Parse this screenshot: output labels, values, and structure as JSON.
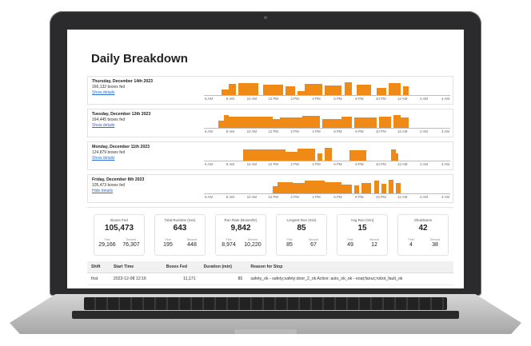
{
  "page": {
    "title": "Daily Breakdown"
  },
  "hours": [
    "6 AM",
    "8 AM",
    "10 AM",
    "12 PM",
    "2 PM",
    "4 PM",
    "6 PM",
    "8 PM",
    "10 PM",
    "12 AM",
    "2 AM",
    "4 AM"
  ],
  "days": [
    {
      "date": "Thursday, December 14th 2023",
      "boxes": "166,132 boxes fed",
      "link": "Show details",
      "runs": [
        [
          0.07,
          0.1,
          0.4
        ],
        [
          0.1,
          0.13,
          0.8
        ],
        [
          0.14,
          0.22,
          0.85
        ],
        [
          0.24,
          0.32,
          0.7
        ],
        [
          0.33,
          0.37,
          0.6
        ],
        [
          0.38,
          0.41,
          0.3
        ],
        [
          0.41,
          0.48,
          0.75
        ],
        [
          0.49,
          0.56,
          0.65
        ],
        [
          0.57,
          0.6,
          0.9
        ],
        [
          0.62,
          0.68,
          0.7
        ],
        [
          0.7,
          0.74,
          0.5
        ],
        [
          0.75,
          0.8,
          0.85
        ],
        [
          0.81,
          0.83,
          0.6
        ]
      ]
    },
    {
      "date": "Tuesday, December 12th 2023",
      "boxes": "164,445 boxes fed",
      "link": "Show details",
      "runs": [
        [
          0.06,
          0.08,
          0.5
        ],
        [
          0.08,
          0.1,
          0.9
        ],
        [
          0.1,
          0.2,
          0.8
        ],
        [
          0.2,
          0.28,
          0.75
        ],
        [
          0.28,
          0.31,
          0.6
        ],
        [
          0.31,
          0.4,
          0.7
        ],
        [
          0.4,
          0.47,
          0.85
        ],
        [
          0.48,
          0.56,
          0.6
        ],
        [
          0.56,
          0.6,
          0.8
        ],
        [
          0.61,
          0.7,
          0.7
        ],
        [
          0.71,
          0.76,
          0.75
        ],
        [
          0.77,
          0.8,
          0.9
        ],
        [
          0.8,
          0.83,
          0.7
        ]
      ]
    },
    {
      "date": "Monday, December 11th 2023",
      "boxes": "124,879 boxes fed",
      "link": "Show details",
      "runs": [
        [
          0.16,
          0.33,
          0.75
        ],
        [
          0.33,
          0.38,
          0.6
        ],
        [
          0.38,
          0.45,
          0.85
        ],
        [
          0.46,
          0.48,
          0.5
        ],
        [
          0.49,
          0.52,
          0.9
        ],
        [
          0.59,
          0.66,
          0.7
        ],
        [
          0.76,
          0.78,
          0.8
        ],
        [
          0.78,
          0.79,
          0.5
        ]
      ]
    },
    {
      "date": "Friday, December 8th 2023",
      "boxes": "105,473 boxes fed",
      "link": "Hide details",
      "runs": [
        [
          0.28,
          0.3,
          0.5
        ],
        [
          0.3,
          0.36,
          0.8
        ],
        [
          0.36,
          0.41,
          0.7
        ],
        [
          0.41,
          0.49,
          0.9
        ],
        [
          0.49,
          0.56,
          0.75
        ],
        [
          0.56,
          0.6,
          0.6
        ],
        [
          0.61,
          0.63,
          0.55
        ],
        [
          0.64,
          0.68,
          0.7
        ],
        [
          0.69,
          0.71,
          0.9
        ],
        [
          0.72,
          0.74,
          0.65
        ],
        [
          0.75,
          0.77,
          0.95
        ],
        [
          0.78,
          0.8,
          0.7
        ]
      ]
    }
  ],
  "stats": [
    {
      "title": "Boxes Fed",
      "value": "105,473",
      "first_label": "First",
      "first": "29,166",
      "second_label": "Second",
      "second": "76,307"
    },
    {
      "title": "Total Runtime (min)",
      "value": "643",
      "first_label": "First",
      "first": "195",
      "second_label": "Second",
      "second": "448"
    },
    {
      "title": "Run Rate (Boxes/hr)",
      "value": "9,842",
      "first_label": "First",
      "first": "8,974",
      "second_label": "Second",
      "second": "10,220"
    },
    {
      "title": "Longest Run (min)",
      "value": "85",
      "first_label": "First",
      "first": "85",
      "second_label": "Second",
      "second": "67"
    },
    {
      "title": "Avg Run (min)",
      "value": "15",
      "first_label": "First",
      "first": "49",
      "second_label": "Second",
      "second": "12"
    },
    {
      "title": "Shutdowns",
      "value": "42",
      "first_label": "First",
      "first": "4",
      "second_label": "Second",
      "second": "38"
    }
  ],
  "table": {
    "headers": {
      "shift": "Shift",
      "start": "Start Time",
      "boxes": "Boxes Fed",
      "duration": "Duration (min)",
      "reason": "Reason for Stop"
    },
    "rows": [
      {
        "shift": "first",
        "start": "2023-12-08 12:16",
        "boxes": "11,171",
        "duration": "85",
        "reason": "safety_ok - safety;safety;door_2_ok Active: auto_ok_ok - eoat;fanuc;robot_fault_ok"
      }
    ]
  },
  "colors": {
    "accent": "#ef8a17",
    "link": "#2a6fd6"
  }
}
